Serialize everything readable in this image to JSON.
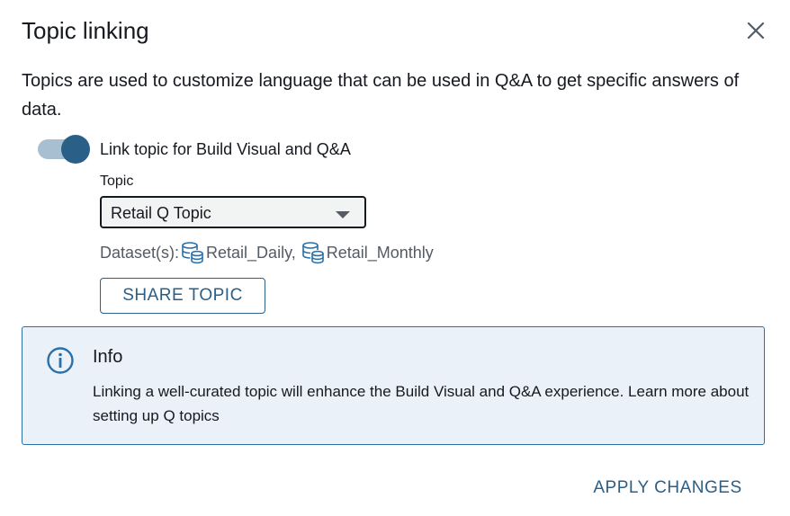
{
  "dialog": {
    "title": "Topic linking",
    "description": "Topics are used to customize language that can be used in Q&A to get specific answers of data."
  },
  "toggle": {
    "label": "Link topic for Build Visual and Q&A",
    "checked": true
  },
  "topic": {
    "label": "Topic",
    "selected": "Retail Q Topic"
  },
  "datasets": {
    "prefix": "Dataset(s):",
    "items": [
      {
        "name": "Retail_Daily,",
        "icon": "database-icon"
      },
      {
        "name": "Retail_Monthly",
        "icon": "database-icon"
      }
    ]
  },
  "buttons": {
    "share": "SHARE TOPIC",
    "apply": "APPLY CHANGES"
  },
  "info": {
    "title": "Info",
    "body": "Linking a well-curated topic will enhance the Build Visual and Q&A experience. Learn more about setting up Q topics"
  },
  "colors": {
    "accent": "#2a5f87",
    "info_border": "#2a6fa8",
    "info_bg": "#ebf1f8",
    "text": "#16191f",
    "muted": "#545b64"
  }
}
